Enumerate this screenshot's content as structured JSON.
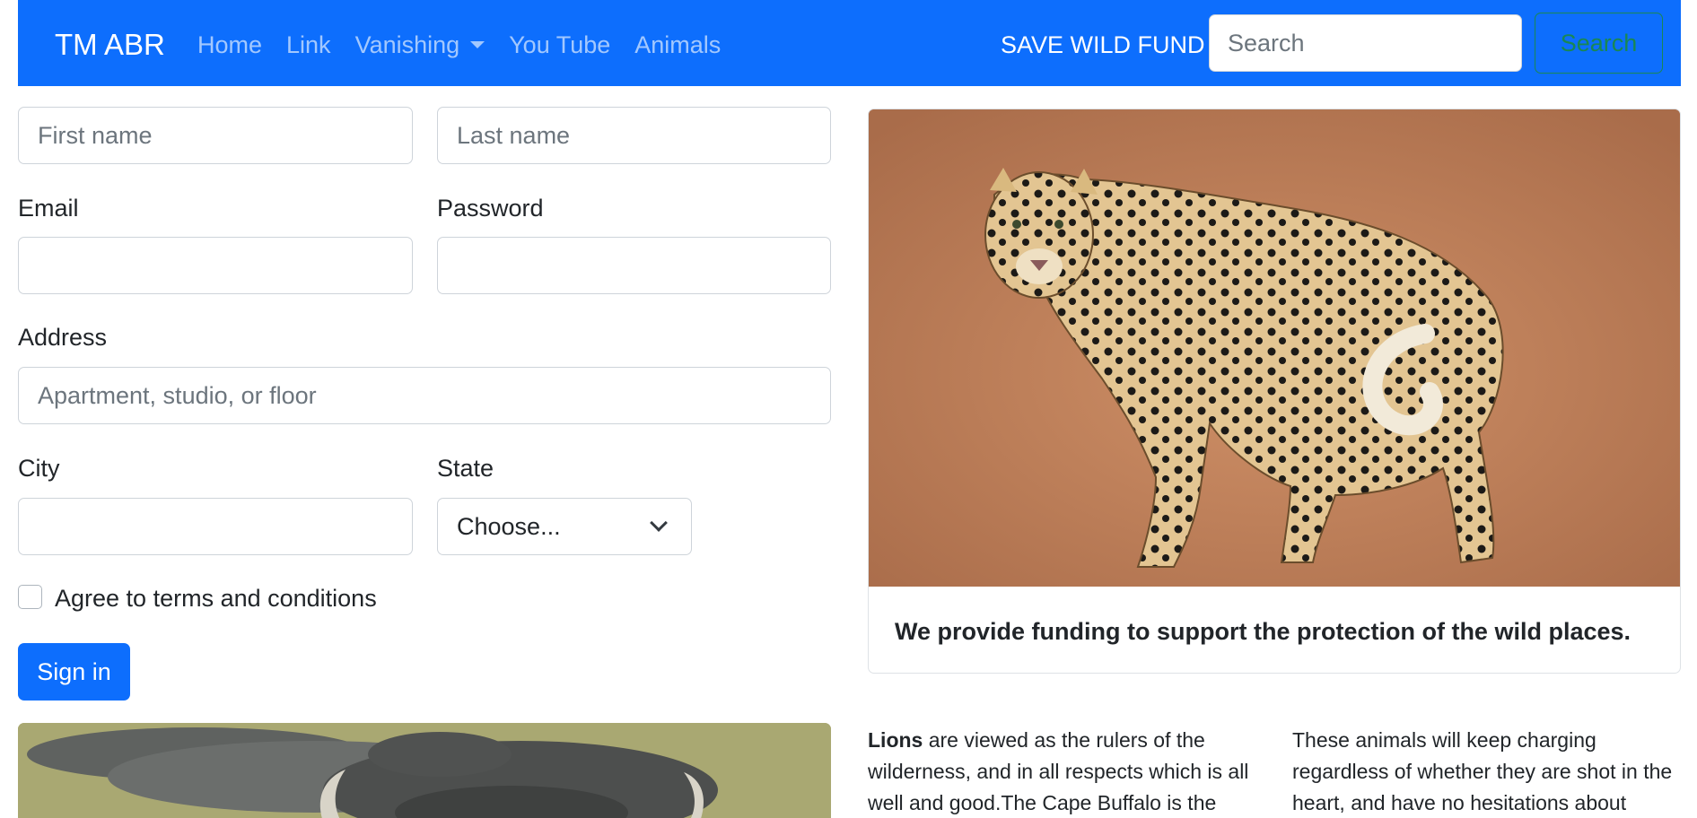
{
  "navbar": {
    "brand": "TM ABR",
    "links": [
      "Home",
      "Link",
      "Vanishing",
      "You Tube",
      "Animals"
    ],
    "fund_text": "SAVE WILD FUND",
    "search_placeholder": "Search",
    "search_button": "Search",
    "color": "#0d6efd"
  },
  "form": {
    "first_name_placeholder": "First name",
    "last_name_placeholder": "Last name",
    "email_label": "Email",
    "password_label": "Password",
    "address_label": "Address",
    "address_placeholder": "Apartment, studio, or floor",
    "city_label": "City",
    "state_label": "State",
    "state_selected": "Choose...",
    "terms_label": "Agree to terms and conditions",
    "signin_label": "Sign in"
  },
  "card": {
    "image_subject": "leopard",
    "caption": "We provide funding to support the protection of the wild places."
  },
  "bottom_image_subject": "buffalo",
  "columns": {
    "left_bold": "Lions",
    "left_text": " are viewed as the rulers of the wilderness, and in all respects which is all well and good.The Cape Buffalo is the",
    "right_text": "These animals will keep charging regardless of whether they are shot in the heart, and have no hesitations about"
  }
}
